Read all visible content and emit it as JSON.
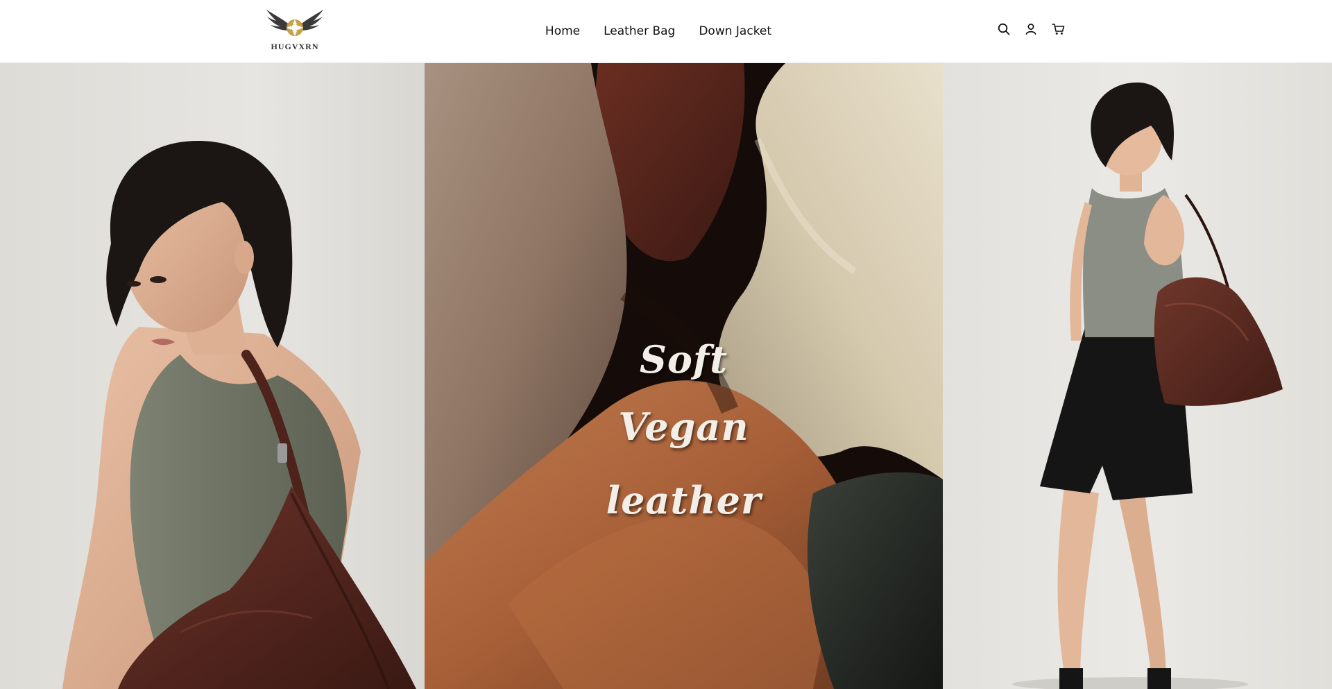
{
  "brand": {
    "name": "HUGVXRN"
  },
  "nav": {
    "items": [
      {
        "label": "Home"
      },
      {
        "label": "Leather Bag"
      },
      {
        "label": "Down Jacket"
      }
    ]
  },
  "header_icons": [
    "search-icon",
    "account-icon",
    "cart-icon"
  ],
  "hero": {
    "words": [
      "Soft",
      "Vegan",
      "leather"
    ]
  },
  "colors": {
    "accent_gold": "#c7a04a",
    "leather_brown": "#5a2a22",
    "header_bg": "#ffffff"
  }
}
